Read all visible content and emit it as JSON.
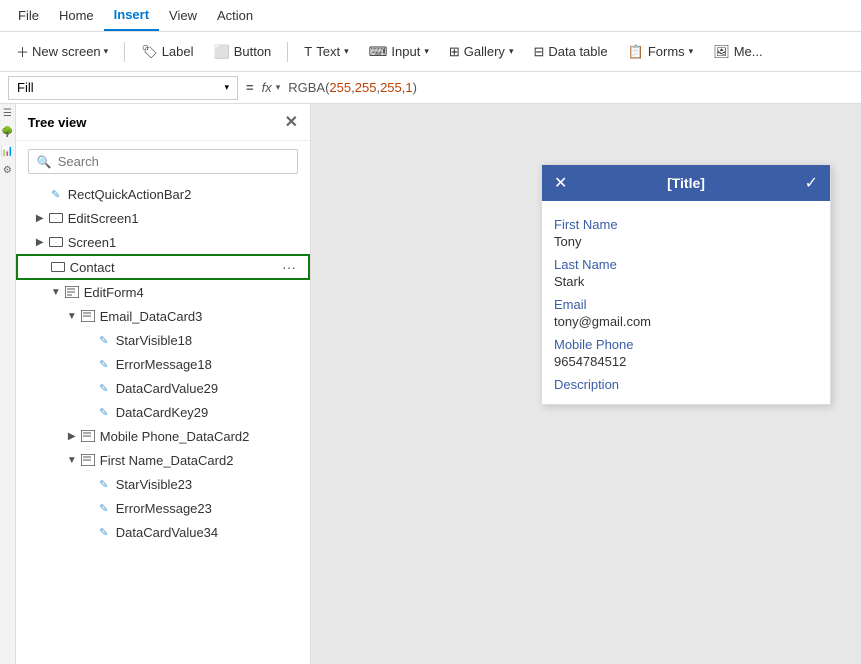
{
  "menubar": {
    "items": [
      "File",
      "Home",
      "Insert",
      "View",
      "Action"
    ],
    "active": "Insert"
  },
  "toolbar": {
    "new_screen_label": "New screen",
    "label_label": "Label",
    "button_label": "Button",
    "text_label": "Text",
    "input_label": "Input",
    "gallery_label": "Gallery",
    "data_table_label": "Data table",
    "forms_label": "Forms",
    "media_label": "Me..."
  },
  "formulabar": {
    "fill_label": "Fill",
    "equals_label": "=",
    "fx_label": "fx",
    "formula": "RGBA(255, 255, 255, 1)",
    "formula_func": "RGBA(",
    "formula_n1": "255",
    "formula_sep1": ", ",
    "formula_n2": "255",
    "formula_sep2": ", ",
    "formula_n3": "255",
    "formula_sep3": ", ",
    "formula_n4": "1",
    "formula_close": ")"
  },
  "treeview": {
    "title": "Tree view",
    "search_placeholder": "Search",
    "items": [
      {
        "id": "rectquick",
        "label": "RectQuickActionBar2",
        "indent": "indent1",
        "type": "edit",
        "chevron": "",
        "expanded": false
      },
      {
        "id": "editscreen1",
        "label": "EditScreen1",
        "indent": "indent1",
        "type": "screen",
        "chevron": "▶",
        "expanded": false
      },
      {
        "id": "screen1",
        "label": "Screen1",
        "indent": "indent1",
        "type": "screen",
        "chevron": "▶",
        "expanded": false
      },
      {
        "id": "contact",
        "label": "Contact",
        "indent": "indent1",
        "type": "screen",
        "chevron": "",
        "expanded": false,
        "highlighted": true,
        "showmore": true
      },
      {
        "id": "editform4",
        "label": "EditForm4",
        "indent": "indent2",
        "type": "form",
        "chevron": "▼",
        "expanded": true
      },
      {
        "id": "email_datacard3",
        "label": "Email_DataCard3",
        "indent": "indent3",
        "type": "form",
        "chevron": "▼",
        "expanded": true
      },
      {
        "id": "starvisible18",
        "label": "StarVisible18",
        "indent": "indent4",
        "type": "edit",
        "chevron": "",
        "expanded": false
      },
      {
        "id": "errormessage18",
        "label": "ErrorMessage18",
        "indent": "indent4",
        "type": "edit",
        "chevron": "",
        "expanded": false
      },
      {
        "id": "datacardvalue29",
        "label": "DataCardValue29",
        "indent": "indent4",
        "type": "edit",
        "chevron": "",
        "expanded": false
      },
      {
        "id": "datacardkey29",
        "label": "DataCardKey29",
        "indent": "indent4",
        "type": "edit",
        "chevron": "",
        "expanded": false
      },
      {
        "id": "mobilephone_datacard2",
        "label": "Mobile Phone_DataCard2",
        "indent": "indent3",
        "type": "form",
        "chevron": "▶",
        "expanded": false
      },
      {
        "id": "firstname_datacard2",
        "label": "First Name_DataCard2",
        "indent": "indent3",
        "type": "form",
        "chevron": "▼",
        "expanded": true
      },
      {
        "id": "starvisible23",
        "label": "StarVisible23",
        "indent": "indent4",
        "type": "edit",
        "chevron": "",
        "expanded": false
      },
      {
        "id": "errormessage23",
        "label": "ErrorMessage23",
        "indent": "indent4",
        "type": "edit",
        "chevron": "",
        "expanded": false
      },
      {
        "id": "datacardvalue34",
        "label": "DataCardValue34",
        "indent": "indent4",
        "type": "edit",
        "chevron": "",
        "expanded": false
      }
    ]
  },
  "formcard": {
    "title": "[Title]",
    "close_icon": "✕",
    "check_icon": "✓",
    "fields": [
      {
        "label": "First Name",
        "value": "Tony"
      },
      {
        "label": "Last Name",
        "value": "Stark"
      },
      {
        "label": "Email",
        "value": "tony@gmail.com"
      },
      {
        "label": "Mobile Phone",
        "value": "9654784512"
      },
      {
        "label": "Description",
        "value": ""
      }
    ]
  }
}
